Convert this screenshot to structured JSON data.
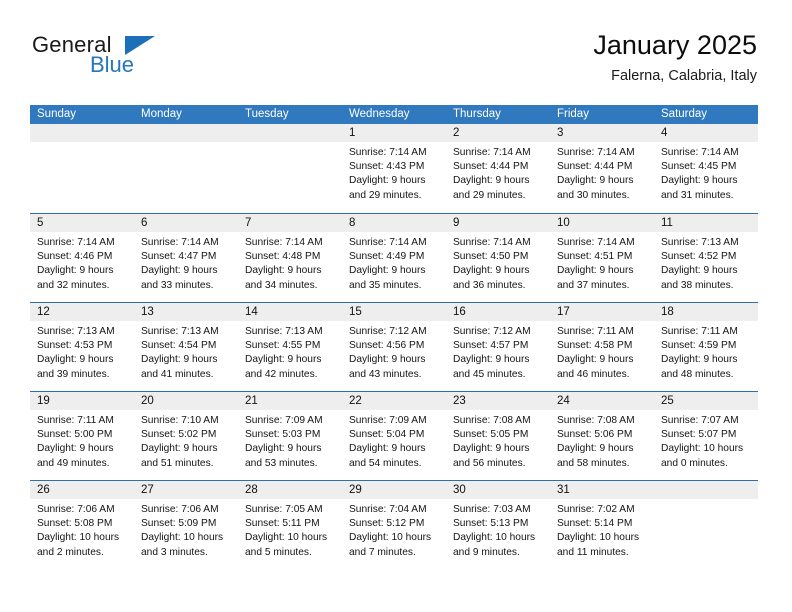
{
  "brand": {
    "name_part1": "General",
    "name_part2": "Blue",
    "mark": "triangle-flag-icon",
    "accent_color": "#1d6fb8"
  },
  "header": {
    "title": "January 2025",
    "subtitle": "Falerna, Calabria, Italy"
  },
  "theme": {
    "header_bar_color": "#3079bf",
    "row_rule_color": "#2f6fab",
    "day_number_bar_color": "#eeeeee"
  },
  "weekdays": [
    "Sunday",
    "Monday",
    "Tuesday",
    "Wednesday",
    "Thursday",
    "Friday",
    "Saturday"
  ],
  "weeks": [
    [
      {
        "day": "",
        "lines": []
      },
      {
        "day": "",
        "lines": []
      },
      {
        "day": "",
        "lines": []
      },
      {
        "day": "1",
        "lines": [
          "Sunrise: 7:14 AM",
          "Sunset: 4:43 PM",
          "Daylight: 9 hours",
          "and 29 minutes."
        ]
      },
      {
        "day": "2",
        "lines": [
          "Sunrise: 7:14 AM",
          "Sunset: 4:44 PM",
          "Daylight: 9 hours",
          "and 29 minutes."
        ]
      },
      {
        "day": "3",
        "lines": [
          "Sunrise: 7:14 AM",
          "Sunset: 4:44 PM",
          "Daylight: 9 hours",
          "and 30 minutes."
        ]
      },
      {
        "day": "4",
        "lines": [
          "Sunrise: 7:14 AM",
          "Sunset: 4:45 PM",
          "Daylight: 9 hours",
          "and 31 minutes."
        ]
      }
    ],
    [
      {
        "day": "5",
        "lines": [
          "Sunrise: 7:14 AM",
          "Sunset: 4:46 PM",
          "Daylight: 9 hours",
          "and 32 minutes."
        ]
      },
      {
        "day": "6",
        "lines": [
          "Sunrise: 7:14 AM",
          "Sunset: 4:47 PM",
          "Daylight: 9 hours",
          "and 33 minutes."
        ]
      },
      {
        "day": "7",
        "lines": [
          "Sunrise: 7:14 AM",
          "Sunset: 4:48 PM",
          "Daylight: 9 hours",
          "and 34 minutes."
        ]
      },
      {
        "day": "8",
        "lines": [
          "Sunrise: 7:14 AM",
          "Sunset: 4:49 PM",
          "Daylight: 9 hours",
          "and 35 minutes."
        ]
      },
      {
        "day": "9",
        "lines": [
          "Sunrise: 7:14 AM",
          "Sunset: 4:50 PM",
          "Daylight: 9 hours",
          "and 36 minutes."
        ]
      },
      {
        "day": "10",
        "lines": [
          "Sunrise: 7:14 AM",
          "Sunset: 4:51 PM",
          "Daylight: 9 hours",
          "and 37 minutes."
        ]
      },
      {
        "day": "11",
        "lines": [
          "Sunrise: 7:13 AM",
          "Sunset: 4:52 PM",
          "Daylight: 9 hours",
          "and 38 minutes."
        ]
      }
    ],
    [
      {
        "day": "12",
        "lines": [
          "Sunrise: 7:13 AM",
          "Sunset: 4:53 PM",
          "Daylight: 9 hours",
          "and 39 minutes."
        ]
      },
      {
        "day": "13",
        "lines": [
          "Sunrise: 7:13 AM",
          "Sunset: 4:54 PM",
          "Daylight: 9 hours",
          "and 41 minutes."
        ]
      },
      {
        "day": "14",
        "lines": [
          "Sunrise: 7:13 AM",
          "Sunset: 4:55 PM",
          "Daylight: 9 hours",
          "and 42 minutes."
        ]
      },
      {
        "day": "15",
        "lines": [
          "Sunrise: 7:12 AM",
          "Sunset: 4:56 PM",
          "Daylight: 9 hours",
          "and 43 minutes."
        ]
      },
      {
        "day": "16",
        "lines": [
          "Sunrise: 7:12 AM",
          "Sunset: 4:57 PM",
          "Daylight: 9 hours",
          "and 45 minutes."
        ]
      },
      {
        "day": "17",
        "lines": [
          "Sunrise: 7:11 AM",
          "Sunset: 4:58 PM",
          "Daylight: 9 hours",
          "and 46 minutes."
        ]
      },
      {
        "day": "18",
        "lines": [
          "Sunrise: 7:11 AM",
          "Sunset: 4:59 PM",
          "Daylight: 9 hours",
          "and 48 minutes."
        ]
      }
    ],
    [
      {
        "day": "19",
        "lines": [
          "Sunrise: 7:11 AM",
          "Sunset: 5:00 PM",
          "Daylight: 9 hours",
          "and 49 minutes."
        ]
      },
      {
        "day": "20",
        "lines": [
          "Sunrise: 7:10 AM",
          "Sunset: 5:02 PM",
          "Daylight: 9 hours",
          "and 51 minutes."
        ]
      },
      {
        "day": "21",
        "lines": [
          "Sunrise: 7:09 AM",
          "Sunset: 5:03 PM",
          "Daylight: 9 hours",
          "and 53 minutes."
        ]
      },
      {
        "day": "22",
        "lines": [
          "Sunrise: 7:09 AM",
          "Sunset: 5:04 PM",
          "Daylight: 9 hours",
          "and 54 minutes."
        ]
      },
      {
        "day": "23",
        "lines": [
          "Sunrise: 7:08 AM",
          "Sunset: 5:05 PM",
          "Daylight: 9 hours",
          "and 56 minutes."
        ]
      },
      {
        "day": "24",
        "lines": [
          "Sunrise: 7:08 AM",
          "Sunset: 5:06 PM",
          "Daylight: 9 hours",
          "and 58 minutes."
        ]
      },
      {
        "day": "25",
        "lines": [
          "Sunrise: 7:07 AM",
          "Sunset: 5:07 PM",
          "Daylight: 10 hours",
          "and 0 minutes."
        ]
      }
    ],
    [
      {
        "day": "26",
        "lines": [
          "Sunrise: 7:06 AM",
          "Sunset: 5:08 PM",
          "Daylight: 10 hours",
          "and 2 minutes."
        ]
      },
      {
        "day": "27",
        "lines": [
          "Sunrise: 7:06 AM",
          "Sunset: 5:09 PM",
          "Daylight: 10 hours",
          "and 3 minutes."
        ]
      },
      {
        "day": "28",
        "lines": [
          "Sunrise: 7:05 AM",
          "Sunset: 5:11 PM",
          "Daylight: 10 hours",
          "and 5 minutes."
        ]
      },
      {
        "day": "29",
        "lines": [
          "Sunrise: 7:04 AM",
          "Sunset: 5:12 PM",
          "Daylight: 10 hours",
          "and 7 minutes."
        ]
      },
      {
        "day": "30",
        "lines": [
          "Sunrise: 7:03 AM",
          "Sunset: 5:13 PM",
          "Daylight: 10 hours",
          "and 9 minutes."
        ]
      },
      {
        "day": "31",
        "lines": [
          "Sunrise: 7:02 AM",
          "Sunset: 5:14 PM",
          "Daylight: 10 hours",
          "and 11 minutes."
        ]
      },
      {
        "day": "",
        "lines": []
      }
    ]
  ]
}
